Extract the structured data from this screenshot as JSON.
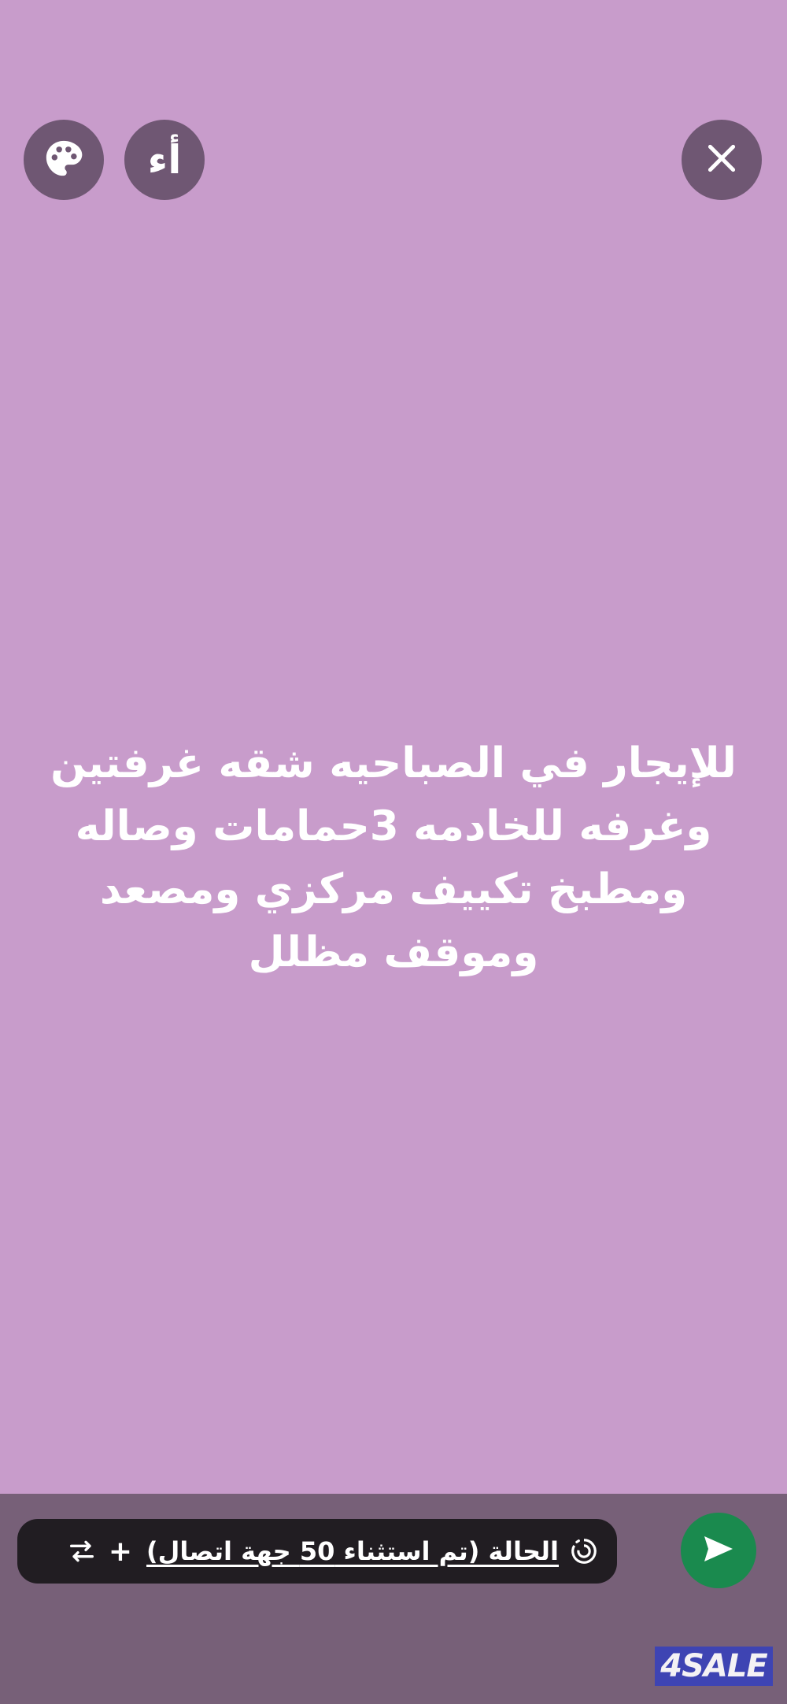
{
  "toolbar": {
    "palette_icon": "palette-icon",
    "font_button_label": "أء",
    "close_icon": "close-icon"
  },
  "status": {
    "text": "للإيجار في الصباحيه شقه غرفتين\nوغرفه للخادمه 3حمامات وصاله\nومطبخ تكييف مركزي ومصعد\nوموقف مظلل"
  },
  "composer": {
    "audience_label": "الحالة (تم استثناء 50 جهة اتصال)",
    "add_label": "+",
    "status_icon": "status-ring-icon",
    "switch_icon": "switch-arrows-icon",
    "send_icon": "send-icon"
  },
  "watermark": {
    "text": "4SALE"
  },
  "colors": {
    "background": "#c89ccb",
    "bottom_bar": "#776078",
    "button_bg": "#6f5773",
    "pill_bg": "#211d22",
    "send_green": "#1a8a4e",
    "watermark_blue": "#3a42b8"
  }
}
